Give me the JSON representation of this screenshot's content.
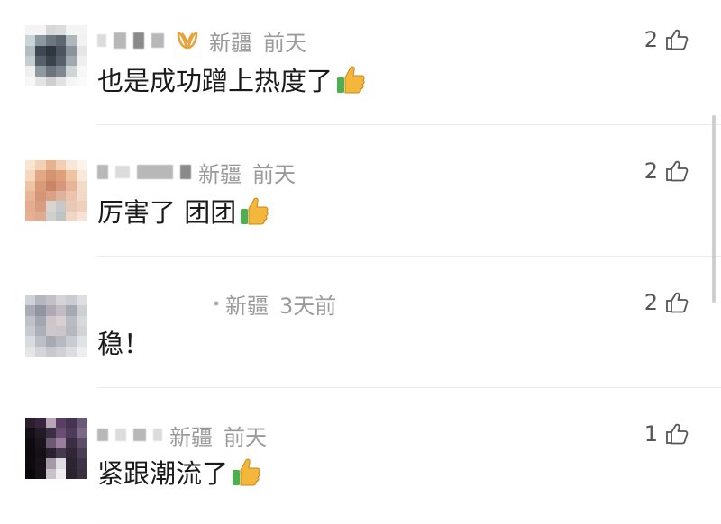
{
  "comments": [
    {
      "location": "新疆",
      "time": "前天",
      "text": "也是成功蹭上热度了",
      "emoji": "thumbs-up-emoji",
      "likes": "2",
      "has_badge": true
    },
    {
      "location": "新疆",
      "time": "前天",
      "text": "厉害了 团团",
      "emoji": "thumbs-up-emoji",
      "likes": "2",
      "has_badge": false
    },
    {
      "location": "新疆",
      "time": "3天前",
      "text": "稳！",
      "emoji": "",
      "likes": "2",
      "has_badge": false
    },
    {
      "location": "新疆",
      "time": "前天",
      "text": "紧跟潮流了",
      "emoji": "thumbs-up-emoji",
      "likes": "1",
      "has_badge": false
    }
  ],
  "colors": {
    "meta_text": "#9a9a9a",
    "comment_text": "#1a1a1a",
    "badge": "#e8a23c",
    "thumb_green": "#4caf50",
    "thumb_yellow": "#f4b63b"
  },
  "icons": {
    "like": "thumbs-up-outline-icon",
    "badge": "fan-badge-icon",
    "emoji": "thumbs-up-emoji"
  }
}
